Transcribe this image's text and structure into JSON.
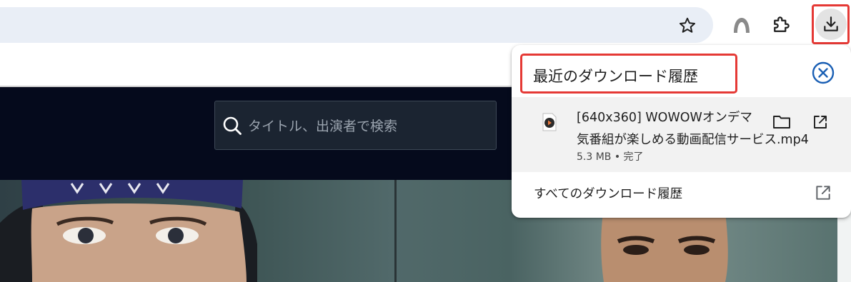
{
  "toolbar": {
    "icons": [
      "star-icon",
      "profile-icon",
      "extensions-icon",
      "download-icon"
    ]
  },
  "site": {
    "search": {
      "placeholder": "タイトル、出演者で検索"
    }
  },
  "download_bubble": {
    "title": "最近のダウンロード履歴",
    "item": {
      "name_line1": "[640x360] WOWOWオンデマ",
      "name_line2": "気番組が楽しめる動画配信サービス.mp4",
      "size": "5.3 MB",
      "status": "完了",
      "meta": "5.3 MB • 完了"
    },
    "all_history_label": "すべてのダウンロード履歴"
  },
  "colors": {
    "highlight": "#e53935",
    "close_icon": "#1a5fb4",
    "site_header": "#050a1c"
  }
}
